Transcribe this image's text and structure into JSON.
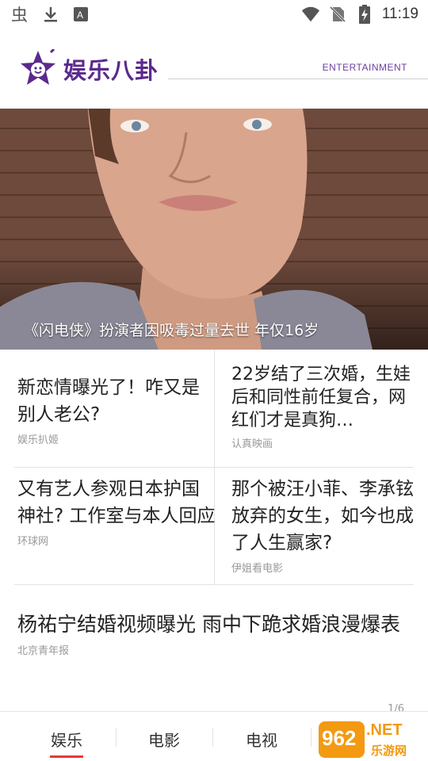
{
  "status_bar": {
    "time": "11:19",
    "icons": [
      "bug-icon",
      "download-icon",
      "keyboard-icon",
      "wifi-icon",
      "no-sim-icon",
      "battery-charging-icon"
    ]
  },
  "header": {
    "brand": "娱乐八卦",
    "subtitle": "ENTERTAINMENT",
    "logo_icon": "star-face-logo",
    "accent": "#5b2a8c"
  },
  "hero": {
    "caption": "《闪电侠》扮演者因吸毒过量去世 年仅16岁"
  },
  "news": [
    {
      "title": "新恋情曝光了！咋又是别人老公?",
      "source": "娱乐扒姬"
    },
    {
      "title": "22岁结了三次婚，生娃后和同性前任复合，网红们才是真狗…",
      "source": "认真映画"
    },
    {
      "title": "又有艺人参观日本护国神社? 工作室与本人回应",
      "source": "环球网"
    },
    {
      "title": "那个被汪小菲、李承铉放弃的女生，如今也成了人生赢家?",
      "source": "伊姐看电影"
    }
  ],
  "featured": {
    "title": "杨祐宁结婚视频曝光 雨中下跪求婚浪漫爆表",
    "source": "北京青年报"
  },
  "pager": "1/6",
  "tabs": [
    {
      "label": "娱乐",
      "active": true
    },
    {
      "label": "电影",
      "active": false
    },
    {
      "label": "电视",
      "active": false
    }
  ],
  "watermark": {
    "number": "962",
    "net": ".NET",
    "site": "乐游网"
  },
  "colors": {
    "active_tab_underline": "#e53935",
    "watermark": "#f39a12"
  }
}
